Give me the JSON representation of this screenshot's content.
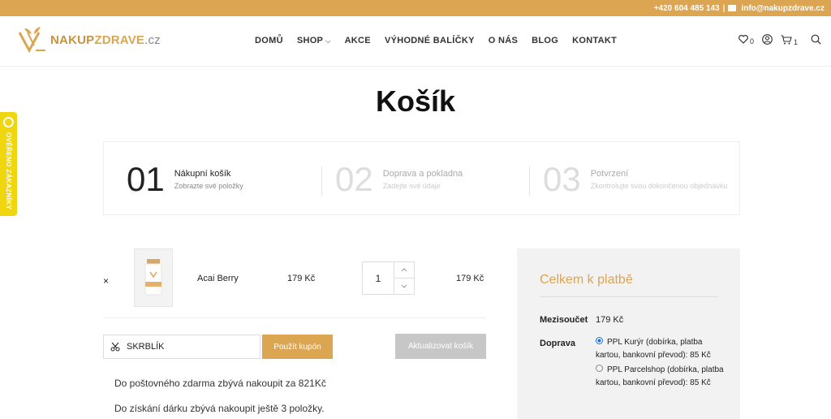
{
  "topbar": {
    "phone": "+420 604 485 143",
    "separator": "|",
    "email": "info@nakupzdrave.cz"
  },
  "logo": {
    "part1": "NAKUP",
    "part2": "ZDRAVE",
    "part3": ".cz"
  },
  "nav": {
    "items": [
      "DOMŮ",
      "SHOP",
      "AKCE",
      "VÝHODNÉ BALÍČKY",
      "O NÁS",
      "BLOG",
      "KONTAKT"
    ],
    "chevron": "⌵"
  },
  "header_icons": {
    "wishlist_count": "0",
    "cart_count": "1"
  },
  "page": {
    "title": "Košík"
  },
  "steps": [
    {
      "num": "01",
      "title": "Nákupní košík",
      "desc": "Zobrazte své položky"
    },
    {
      "num": "02",
      "title": "Doprava a pokladna",
      "desc": "Zadejte své údaje"
    },
    {
      "num": "03",
      "title": "Potvrzení",
      "desc": "Zkontrolujte svou dokončenou objednávku"
    }
  ],
  "cart": {
    "remove": "×",
    "item": {
      "name": "Acai Berry",
      "price": "179 Kč",
      "qty": "1",
      "subtotal": "179 Kč"
    }
  },
  "coupon": {
    "value": "SKRBLÍK",
    "apply": "Použít kupón",
    "update": "Aktualizovat košík"
  },
  "notes": [
    "Do poštovného zdarma zbývá nakoupit za 821Kč",
    "Do získání dárku zbývá nakoupit ještě 3 položky."
  ],
  "totals": {
    "title": "Celkem k platbě",
    "subtotal_label": "Mezisoučet",
    "subtotal_value": "179 Kč",
    "shipping_label": "Doprava",
    "options": [
      {
        "label": "PPL Kurýr (dobírka, platba kartou, bankovní převod): 85 Kč",
        "selected": true
      },
      {
        "label": "PPL Parcelshop (dobírka, platba kartou, bankovní převod): 85 Kč",
        "selected": false
      }
    ]
  },
  "side_badge": {
    "text": "OVĚŘENO ZÁKAZNÍKY"
  },
  "colors": {
    "accent": "#dca552",
    "badge": "#f0d60f",
    "button_gray": "#c7c7c7"
  }
}
